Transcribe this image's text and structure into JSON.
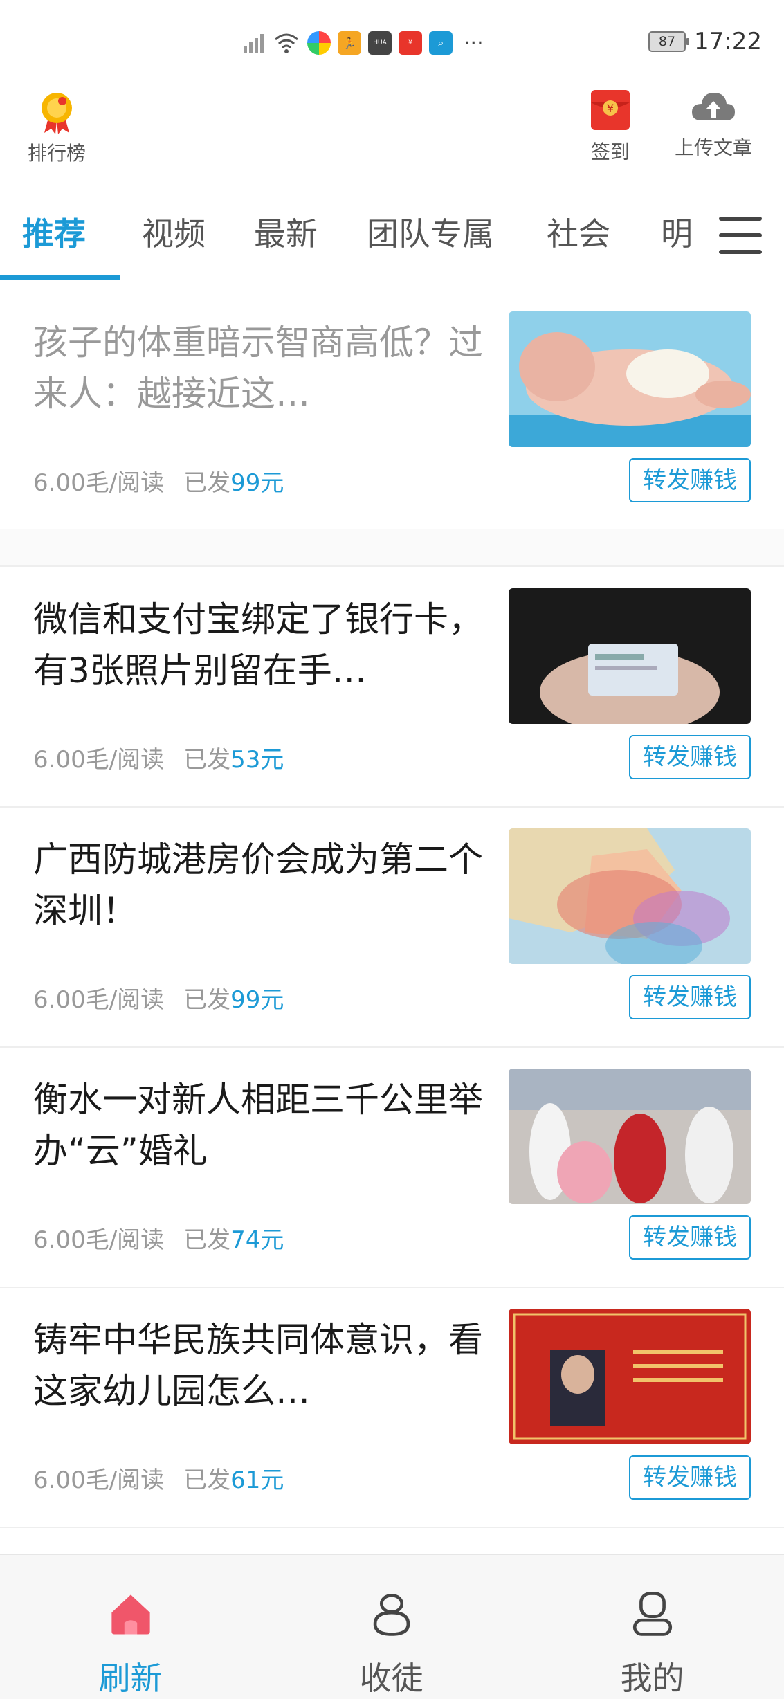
{
  "status_bar": {
    "battery": "87",
    "time": "17:22",
    "overflow": "···"
  },
  "header": {
    "rank_label": "排行榜",
    "checkin_label": "签到",
    "upload_label": "上传文章",
    "checkin_color": "#e8352b"
  },
  "tabs": [
    {
      "label": "推荐",
      "active": true
    },
    {
      "label": "视频"
    },
    {
      "label": "最新"
    },
    {
      "label": "团队专属"
    },
    {
      "label": "社会"
    },
    {
      "label": "明"
    }
  ],
  "articles": [
    {
      "title": "孩子的体重暗示智商高低？过来人：越接近这…",
      "rate": "6.00毛/阅读",
      "sent_prefix": "已发",
      "sent_amount": "99元",
      "share": "转发赚钱",
      "read": true,
      "thumb": "newborn-baby-photo"
    },
    {
      "title": "微信和支付宝绑定了银行卡，有3张照片别留在手…",
      "rate": "6.00毛/阅读",
      "sent_prefix": "已发",
      "sent_amount": "53元",
      "share": "转发赚钱",
      "thumb": "id-card-in-hands-photo"
    },
    {
      "title": "广西防城港房价会成为第二个深圳！",
      "rate": "6.00毛/阅读",
      "sent_prefix": "已发",
      "sent_amount": "99元",
      "share": "转发赚钱",
      "thumb": "map-photo"
    },
    {
      "title": "衡水一对新人相距三千公里举办“云”婚礼",
      "rate": "6.00毛/阅读",
      "sent_prefix": "已发",
      "sent_amount": "74元",
      "share": "转发赚钱",
      "thumb": "wedding-photo"
    },
    {
      "title": "铸牢中华民族共同体意识，看这家幼儿园怎么…",
      "rate": "6.00毛/阅读",
      "sent_prefix": "已发",
      "sent_amount": "61元",
      "share": "转发赚钱",
      "thumb": "red-certificate-photo"
    }
  ],
  "bottom_nav": [
    {
      "label": "刷新",
      "icon": "home-icon",
      "active": true
    },
    {
      "label": "收徒",
      "icon": "apprentice-icon"
    },
    {
      "label": "我的",
      "icon": "profile-icon"
    }
  ],
  "colors": {
    "accent": "#1c9ad6",
    "home_icon": "#f0566a"
  }
}
